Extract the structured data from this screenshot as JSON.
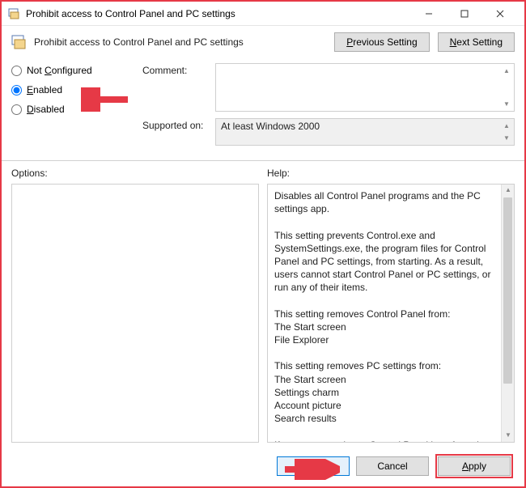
{
  "window": {
    "title": "Prohibit access to Control Panel and PC settings"
  },
  "header": {
    "title": "Prohibit access to Control Panel and PC settings",
    "prev_button": "Previous Setting",
    "next_button": "Next Setting"
  },
  "state": {
    "not_configured": "Not Configured",
    "enabled": "Enabled",
    "disabled": "Disabled",
    "selected": "enabled"
  },
  "meta": {
    "comment_label": "Comment:",
    "comment_value": "",
    "supported_label": "Supported on:",
    "supported_value": "At least Windows 2000"
  },
  "lower": {
    "options_label": "Options:",
    "help_label": "Help:",
    "help_text": "Disables all Control Panel programs and the PC settings app.\n\nThis setting prevents Control.exe and SystemSettings.exe, the program files for Control Panel and PC settings, from starting. As a result, users cannot start Control Panel or PC settings, or run any of their items.\n\nThis setting removes Control Panel from:\nThe Start screen\nFile Explorer\n\nThis setting removes PC settings from:\nThe Start screen\nSettings charm\nAccount picture\nSearch results\n\nIf users try to select a Control Panel item from the Properties item on a context menu, a message appears explaining that a setting prevents the action."
  },
  "footer": {
    "ok": "OK",
    "cancel": "Cancel",
    "apply": "Apply"
  }
}
